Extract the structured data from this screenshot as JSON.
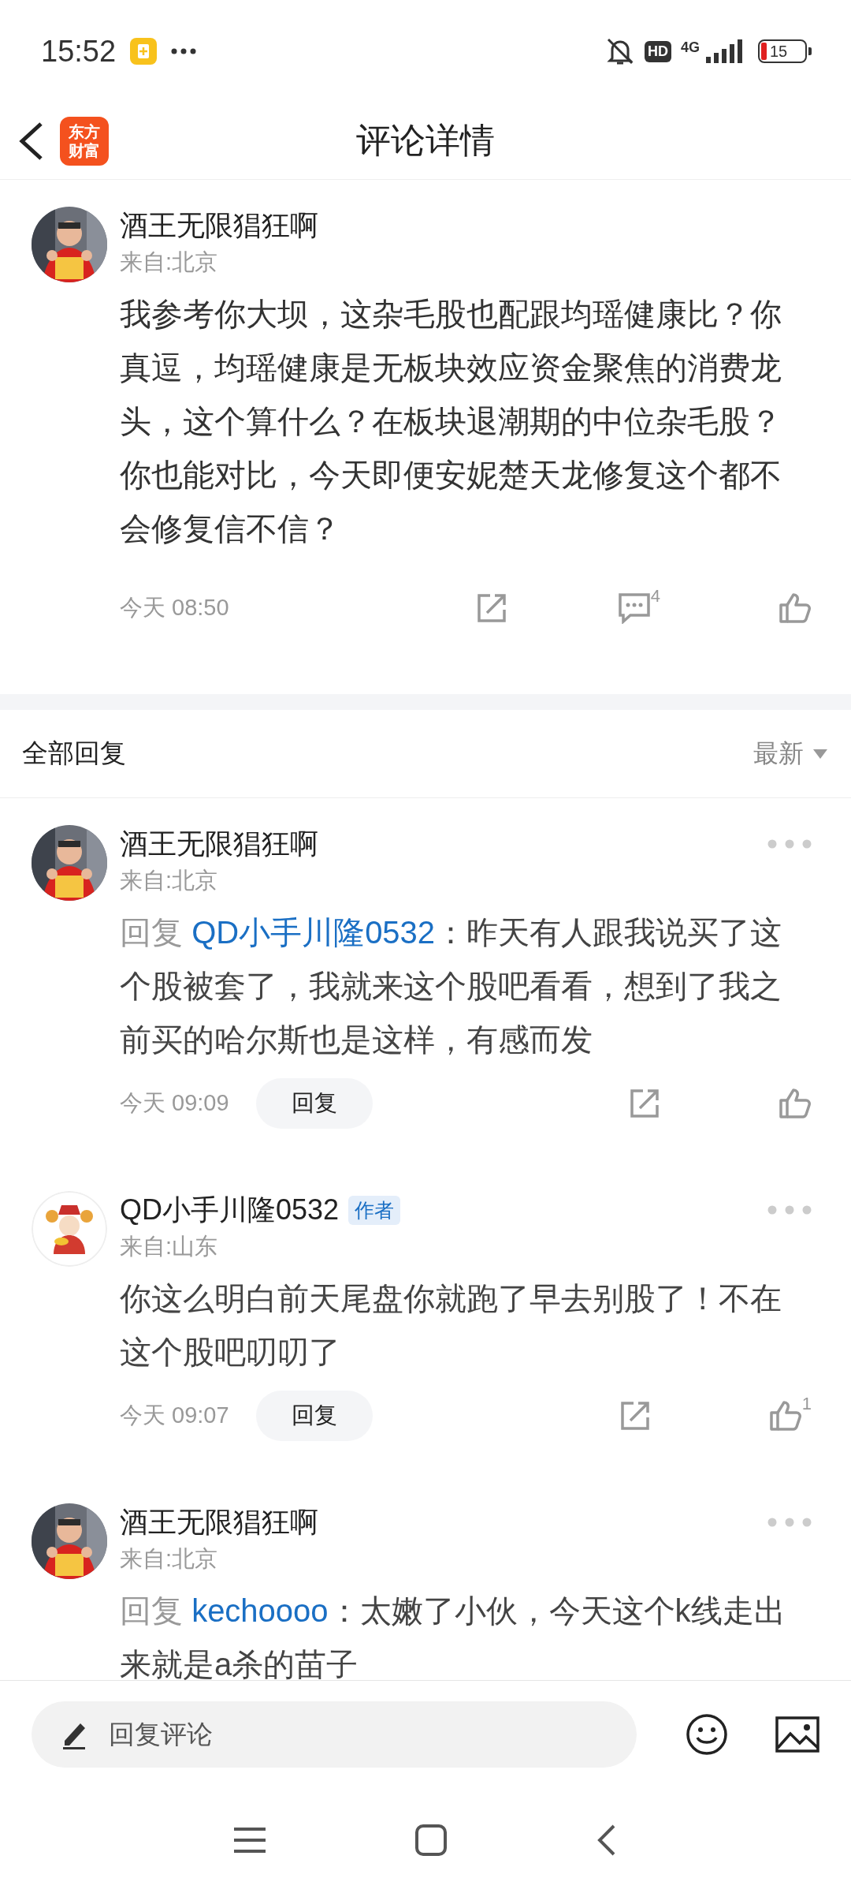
{
  "status_bar": {
    "time": "15:52",
    "hd": "HD",
    "network": "4G",
    "battery": "15"
  },
  "header": {
    "title": "评论详情",
    "logo": [
      "东方",
      "财富"
    ]
  },
  "main_comment": {
    "author": "酒王无限猖狂啊",
    "location": "来自:北京",
    "text": "我参考你大坝，这杂毛股也配跟均瑶健康比？你真逗，均瑶健康是无板块效应资金聚焦的消费龙头，这个算什么？在板块退潮期的中位杂毛股？你也能对比，今天即便安妮楚天龙修复这个都不会修复信不信？",
    "time": "今天 08:50",
    "comment_count": "4"
  },
  "replies_header": {
    "title": "全部回复",
    "sort": "最新"
  },
  "replies": [
    {
      "author": "酒王无限猖狂啊",
      "location": "来自:北京",
      "reply_prefix": "回复",
      "reply_to": "QD小手川隆0532",
      "text": "：昨天有人跟我说买了这个股被套了，我就来这个股吧看看，想到了我之前买的哈尔斯也是这样，有感而发",
      "time": "今天 09:09",
      "reply_button": "回复"
    },
    {
      "author": "QD小手川隆0532",
      "kind": "cartoon",
      "badge": "作者",
      "location": "来自:山东",
      "text": "你这么明白前天尾盘你就跑了早去别股了！不在这个股吧叨叨了",
      "time": "今天 09:07",
      "reply_button": "回复",
      "like_count": "1"
    },
    {
      "author": "酒王无限猖狂啊",
      "location": "来自:北京",
      "reply_prefix": "回复",
      "reply_to": "kechoooo",
      "text": "：太嫩了小伙，今天这个k线走出来就是a杀的苗子"
    }
  ],
  "bottom_bar": {
    "placeholder": "回复评论"
  }
}
